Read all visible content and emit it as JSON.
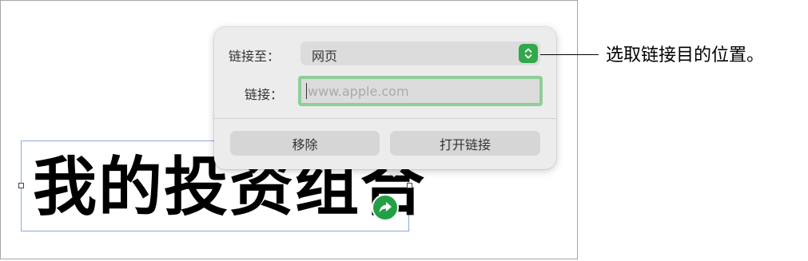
{
  "canvas": {
    "text": "我的投资组合"
  },
  "popover": {
    "link_to_label": "链接至：",
    "link_type_value": "网页",
    "link_label": "链接：",
    "url_value": "",
    "url_placeholder": "www.apple.com",
    "remove_button": "移除",
    "open_link_button": "打开链接"
  },
  "callout": {
    "text": "选取链接目的位置。"
  },
  "colors": {
    "accent_green": "#31a84a",
    "focus_ring": "#8fce98",
    "selection_blue": "#8fa8e0"
  }
}
